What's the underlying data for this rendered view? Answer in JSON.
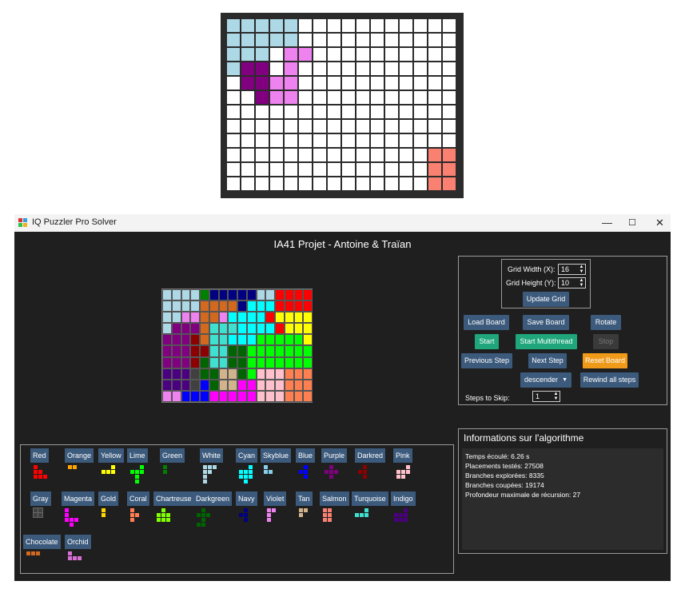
{
  "window": {
    "title": "IQ Puzzler Pro Solver",
    "minimize": "—",
    "maximize": "☐",
    "close": "✕"
  },
  "app_title": "IA41 Projet - Antoine & Traïan",
  "colors": {
    "lightblue": "#add8e6",
    "purple": "#800080",
    "violet": "#ee82ee",
    "salmon": "#fa8072",
    "empty": "#ffffff"
  },
  "top_board": [
    "ccccc...........",
    "cBBBc...........",
    "cBB.MM..........",
    "cPP.M...........",
    ".PPMM...........",
    "..PMM...........",
    "................",
    "................",
    "................",
    "..............SS",
    "..............SS",
    "..............SS"
  ],
  "main_board": [
    "wwwwgNNNNNwwRRRR",
    "wwwwOOOONCCCRRRR",
    "wwvvOOvCCCCRYYYY",
    "wPPPOTTTCCCCRYYY",
    "PPPDOTTCCCLLLLLY",
    "PPPDDTTGGLLLLLLL",
    "PPPDGTTGGLLLLLLL",
    "IIIKGGkkGLpppSSS",
    "IIIKBGkkMMpppSSS",
    "vvBBBMMMMMpppSSS"
  ],
  "settings": {
    "grid_width_label": "Grid Width (X):",
    "grid_width_value": "16",
    "grid_height_label": "Grid Height (Y):",
    "grid_height_value": "10",
    "update_grid": "Update Grid",
    "load_board": "Load Board",
    "save_board": "Save Board",
    "rotate": "Rotate",
    "start": "Start",
    "start_multithread": "Start Multithread",
    "stop": "Stop",
    "previous_step": "Previous Step",
    "next_step": "Next Step",
    "reset_board": "Reset Board",
    "order_select": "descender",
    "rewind_all": "Rewind all steps",
    "steps_to_skip_label": "Steps to Skip:",
    "steps_to_skip_value": "1"
  },
  "info": {
    "title": "Informations sur l'algorithme",
    "lines": [
      "Temps écoulé: 6.26 s",
      "Placements testés: 27508",
      "Branches explorées: 8335",
      "Branches coupées: 19174",
      "Profondeur maximale de récursion: 27"
    ]
  },
  "pieces": [
    {
      "label": "Red",
      "color": "#ff0000"
    },
    {
      "label": "Orange",
      "color": "#ffa500"
    },
    {
      "label": "Yellow",
      "color": "#ffff00"
    },
    {
      "label": "Lime",
      "color": "#00ff00"
    },
    {
      "label": "Green",
      "color": "#008000"
    },
    {
      "label": "White",
      "color": "#add8e6"
    },
    {
      "label": "Cyan",
      "color": "#00ffff"
    },
    {
      "label": "Skyblue",
      "color": "#87ceeb"
    },
    {
      "label": "Blue",
      "color": "#0000ff"
    },
    {
      "label": "Purple",
      "color": "#800080"
    },
    {
      "label": "Darkred",
      "color": "#8b0000"
    },
    {
      "label": "Pink",
      "color": "#ffc0cb"
    },
    {
      "label": "Gray",
      "color": "#404040"
    },
    {
      "label": "Magenta",
      "color": "#ff00ff"
    },
    {
      "label": "Gold",
      "color": "#ffd700"
    },
    {
      "label": "Coral",
      "color": "#ff7f50"
    },
    {
      "label": "Chartreuse",
      "color": "#7fff00"
    },
    {
      "label": "Darkgreen",
      "color": "#006400"
    },
    {
      "label": "Navy",
      "color": "#000080"
    },
    {
      "label": "Violet",
      "color": "#ee82ee"
    },
    {
      "label": "Tan",
      "color": "#d2b48c"
    },
    {
      "label": "Salmon",
      "color": "#fa8072"
    },
    {
      "label": "Turquoise",
      "color": "#40e0d0"
    },
    {
      "label": "Indigo",
      "color": "#4b0082"
    },
    {
      "label": "Chocolate",
      "color": "#d2691e"
    },
    {
      "label": "Orchid",
      "color": "#da70d6"
    }
  ]
}
